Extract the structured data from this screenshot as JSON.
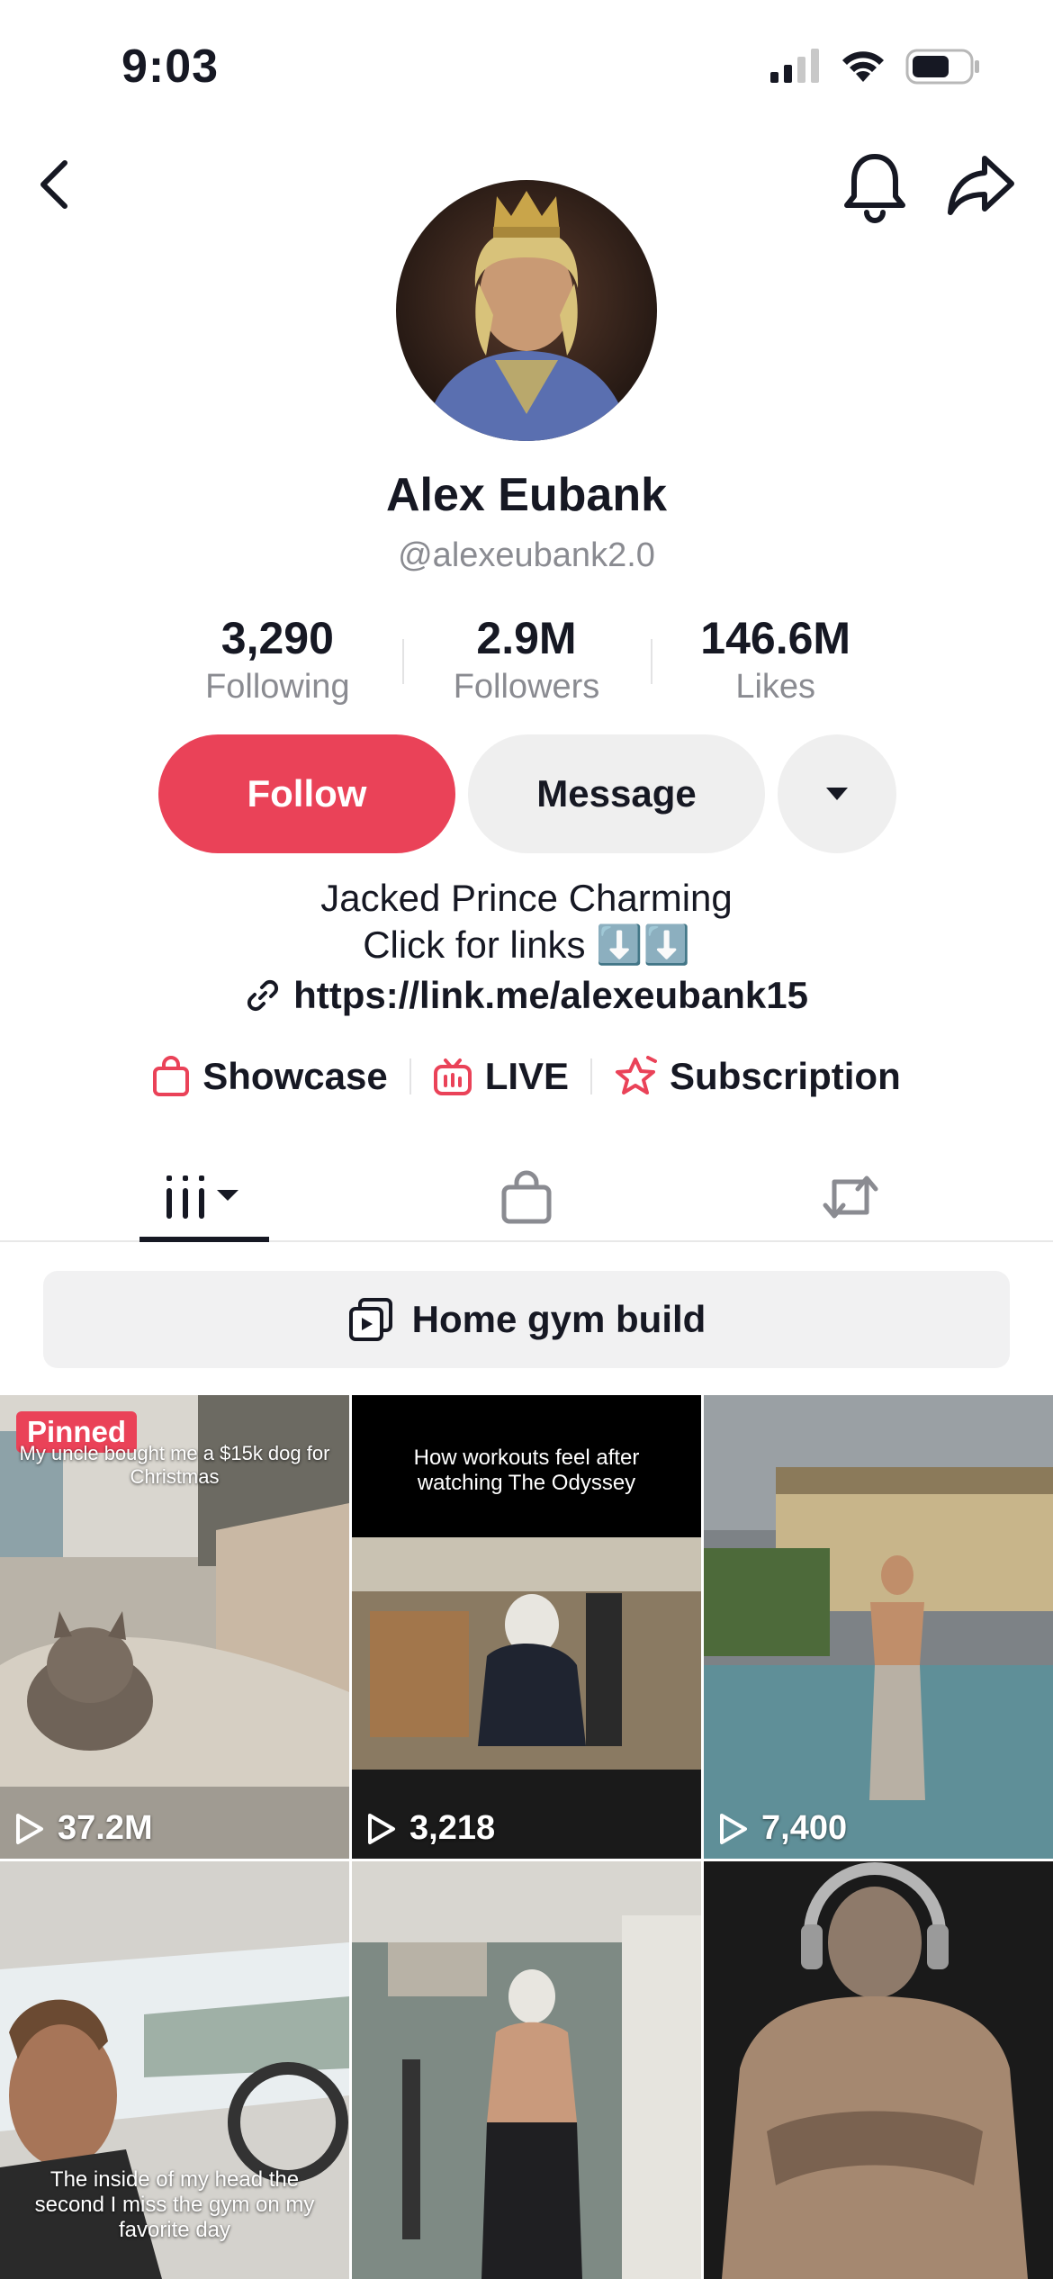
{
  "status_bar": {
    "time": "9:03"
  },
  "profile": {
    "name": "Alex Eubank",
    "handle": "@alexeubank2.0",
    "stats": [
      {
        "value": "3,290",
        "label": "Following"
      },
      {
        "value": "2.9M",
        "label": "Followers"
      },
      {
        "value": "146.6M",
        "label": "Likes"
      }
    ],
    "buttons": {
      "follow": "Follow",
      "message": "Message"
    },
    "bio_line1": "Jacked Prince Charming",
    "bio_line2": "Click for links ⬇️⬇️",
    "link": "https://link.me/alexeubank15"
  },
  "shortcuts": {
    "showcase": "Showcase",
    "live": "LIVE",
    "subscription": "Subscription"
  },
  "playlist": {
    "label": "Home gym build"
  },
  "videos": [
    {
      "views": "37.2M",
      "pinned_label": "Pinned",
      "caption": "My uncle bought me a $15k dog for Christmas"
    },
    {
      "views": "3,218",
      "caption": "How workouts feel after watching The Odyssey"
    },
    {
      "views": "7,400"
    },
    {
      "caption": "The inside of my head the second I miss the gym on my favorite day"
    },
    {},
    {}
  ],
  "colors": {
    "accent": "#ea4258",
    "text": "#161823",
    "muted": "#8a8b91",
    "button_gray": "#efefef"
  }
}
